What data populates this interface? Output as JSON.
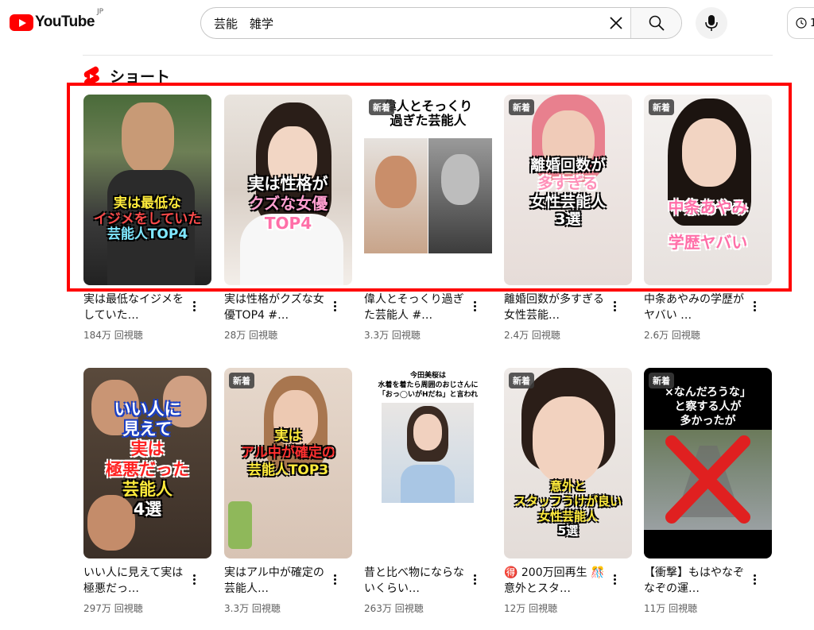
{
  "header": {
    "logo_text": "YouTube",
    "region": "JP",
    "search_value": "芸能　雑学",
    "history_label": "1"
  },
  "section": {
    "title": "ショート"
  },
  "row1": [
    {
      "title": "実は最低なイジメをしていた…",
      "views": "184万 回視聴",
      "thumb_lines": [
        "実は最低な",
        "イジメをしていた",
        "芸能人TOP4"
      ]
    },
    {
      "title": "実は性格がクズな女優TOP4 #…",
      "views": "28万 回視聴",
      "thumb_lines": [
        "実は性格が",
        "クズな女優",
        "TOP4"
      ]
    },
    {
      "title": "偉人とそっくり過ぎた芸能人 #…",
      "views": "3.3万 回視聴",
      "badge": "新着",
      "thumb_lines": [
        "偉人とそっくり",
        "過ぎた芸能人"
      ]
    },
    {
      "title": "離婚回数が多すぎる女性芸能…",
      "views": "2.4万 回視聴",
      "badge": "新着",
      "thumb_lines": [
        "離婚回数が",
        "多すぎる",
        "女性芸能人",
        "3選"
      ]
    },
    {
      "title": "中条あやみの学歴がヤバい …",
      "views": "2.6万 回視聴",
      "badge": "新着",
      "thumb_lines": [
        "中条あやみ",
        "学歴ヤバい"
      ]
    }
  ],
  "row2": [
    {
      "title": "いい人に見えて実は極悪だっ…",
      "views": "297万 回視聴",
      "thumb_lines": [
        "いい人に",
        "見えて",
        "実は",
        "極悪だった",
        "芸能人",
        "4選"
      ]
    },
    {
      "title": "実はアル中が確定の芸能人…",
      "views": "3.3万 回視聴",
      "badge": "新着",
      "thumb_lines": [
        "実は",
        "アル中が確定の",
        "芸能人TOP3"
      ]
    },
    {
      "title": "昔と比べ物にならないくらい…",
      "views": "263万 回視聴",
      "thumb_lines": [
        "今田美桜は",
        "水着を着たら周囲のおじさんに",
        "「おっ◯いがHだね」と言われ"
      ]
    },
    {
      "title": "🉐 200万回再生 🎊 意外とスタ…",
      "views": "12万 回視聴",
      "badge": "新着",
      "thumb_lines": [
        "意外と",
        "スタッフうけが良い",
        "女性芸能人",
        "5選"
      ]
    },
    {
      "title": "【衝撃】もはやなぞなぞの運…",
      "views": "11万 回視聴",
      "badge": "新着",
      "thumb_lines": [
        "×なんだろうな」",
        "と察する人が",
        "多かったが"
      ]
    }
  ],
  "colors": {
    "brand": "#ff0000",
    "highlight": "#ff0000"
  }
}
